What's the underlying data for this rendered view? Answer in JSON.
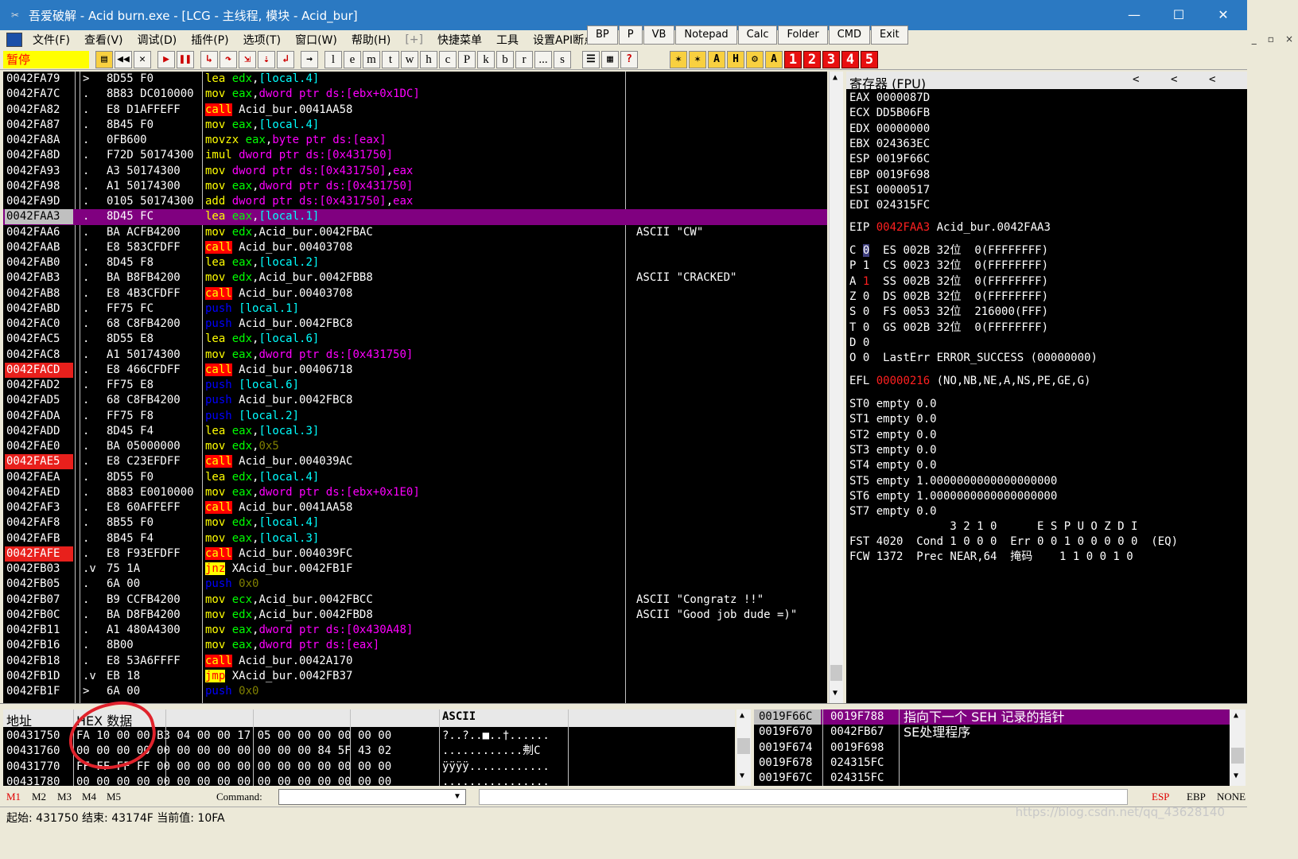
{
  "window": {
    "title": "吾爱破解 - Acid burn.exe - [LCG - 主线程, 模块 - Acid_bur]",
    "minimize": "—",
    "maximize": "☐",
    "close": "✕"
  },
  "menu": {
    "items": [
      "文件(F)",
      "查看(V)",
      "调试(D)",
      "插件(P)",
      "选项(T)",
      "窗口(W)",
      "帮助(H)",
      "[+]",
      "快捷菜单",
      "工具",
      "设置API断点"
    ],
    "quick_buttons": [
      "BP",
      "P",
      "VB",
      "Notepad",
      "Calc",
      "Folder",
      "CMD",
      "Exit"
    ]
  },
  "toolbar": {
    "status": "暂停",
    "letters": [
      "l",
      "e",
      "m",
      "t",
      "w",
      "h",
      "c",
      "P",
      "k",
      "b",
      "r",
      "...",
      "s"
    ],
    "numbers": [
      "1",
      "2",
      "3",
      "4",
      "5"
    ]
  },
  "cpu": {
    "rows": [
      {
        "addr": "0042FA79",
        "g": ">",
        "hex": "8D55 F0",
        "op": "lea",
        "args": "edx,[local.4]",
        "comment": ""
      },
      {
        "addr": "0042FA7C",
        "g": ".",
        "hex": "8B83 DC010000",
        "op": "mov",
        "args": "eax,dword ptr ds:[ebx+0x1DC]",
        "comment": ""
      },
      {
        "addr": "0042FA82",
        "g": ".",
        "hex": "E8 D1AFFEFF",
        "op": "call",
        "args": "Acid_bur.0041AA58",
        "comment": ""
      },
      {
        "addr": "0042FA87",
        "g": ".",
        "hex": "8B45 F0",
        "op": "mov",
        "args": "eax,[local.4]",
        "comment": ""
      },
      {
        "addr": "0042FA8A",
        "g": ".",
        "hex": "0FB600",
        "op": "movzx",
        "args": "eax,byte ptr ds:[eax]",
        "comment": ""
      },
      {
        "addr": "0042FA8D",
        "g": ".",
        "hex": "F72D 50174300",
        "op": "imul",
        "args": "dword ptr ds:[0x431750]",
        "comment": ""
      },
      {
        "addr": "0042FA93",
        "g": ".",
        "hex": "A3 50174300",
        "op": "mov",
        "args": "dword ptr ds:[0x431750],eax",
        "comment": ""
      },
      {
        "addr": "0042FA98",
        "g": ".",
        "hex": "A1 50174300",
        "op": "mov",
        "args": "eax,dword ptr ds:[0x431750]",
        "comment": ""
      },
      {
        "addr": "0042FA9D",
        "g": ".",
        "hex": "0105 50174300",
        "op": "add",
        "args": "dword ptr ds:[0x431750],eax",
        "comment": ""
      },
      {
        "addr": "0042FAA3",
        "g": ".",
        "hex": "8D45 FC",
        "op": "lea",
        "args": "eax,[local.1]",
        "comment": "",
        "selected": true
      },
      {
        "addr": "0042FAA6",
        "g": ".",
        "hex": "BA ACFB4200",
        "op": "mov",
        "args": "edx,Acid_bur.0042FBAC",
        "comment": "ASCII \"CW\""
      },
      {
        "addr": "0042FAAB",
        "g": ".",
        "hex": "E8 583CFDFF",
        "op": "call",
        "args": "Acid_bur.00403708",
        "comment": ""
      },
      {
        "addr": "0042FAB0",
        "g": ".",
        "hex": "8D45 F8",
        "op": "lea",
        "args": "eax,[local.2]",
        "comment": ""
      },
      {
        "addr": "0042FAB3",
        "g": ".",
        "hex": "BA B8FB4200",
        "op": "mov",
        "args": "edx,Acid_bur.0042FBB8",
        "comment": "ASCII \"CRACKED\""
      },
      {
        "addr": "0042FAB8",
        "g": ".",
        "hex": "E8 4B3CFDFF",
        "op": "call",
        "args": "Acid_bur.00403708",
        "comment": ""
      },
      {
        "addr": "0042FABD",
        "g": ".",
        "hex": "FF75 FC",
        "op": "push",
        "args": "[local.1]",
        "comment": ""
      },
      {
        "addr": "0042FAC0",
        "g": ".",
        "hex": "68 C8FB4200",
        "op": "push",
        "args": "Acid_bur.0042FBC8",
        "comment": ""
      },
      {
        "addr": "0042FAC5",
        "g": ".",
        "hex": "8D55 E8",
        "op": "lea",
        "args": "edx,[local.6]",
        "comment": ""
      },
      {
        "addr": "0042FAC8",
        "g": ".",
        "hex": "A1 50174300",
        "op": "mov",
        "args": "eax,dword ptr ds:[0x431750]",
        "comment": ""
      },
      {
        "addr": "0042FACD",
        "g": ".",
        "hex": "E8 466CFDFF",
        "op": "call",
        "args": "Acid_bur.00406718",
        "comment": "",
        "bp": true
      },
      {
        "addr": "0042FAD2",
        "g": ".",
        "hex": "FF75 E8",
        "op": "push",
        "args": "[local.6]",
        "comment": ""
      },
      {
        "addr": "0042FAD5",
        "g": ".",
        "hex": "68 C8FB4200",
        "op": "push",
        "args": "Acid_bur.0042FBC8",
        "comment": ""
      },
      {
        "addr": "0042FADA",
        "g": ".",
        "hex": "FF75 F8",
        "op": "push",
        "args": "[local.2]",
        "comment": ""
      },
      {
        "addr": "0042FADD",
        "g": ".",
        "hex": "8D45 F4",
        "op": "lea",
        "args": "eax,[local.3]",
        "comment": ""
      },
      {
        "addr": "0042FAE0",
        "g": ".",
        "hex": "BA 05000000",
        "op": "mov",
        "args": "edx,0x5",
        "comment": ""
      },
      {
        "addr": "0042FAE5",
        "g": ".",
        "hex": "E8 C23EFDFF",
        "op": "call",
        "args": "Acid_bur.004039AC",
        "comment": "",
        "bp": true
      },
      {
        "addr": "0042FAEA",
        "g": ".",
        "hex": "8D55 F0",
        "op": "lea",
        "args": "edx,[local.4]",
        "comment": ""
      },
      {
        "addr": "0042FAED",
        "g": ".",
        "hex": "8B83 E0010000",
        "op": "mov",
        "args": "eax,dword ptr ds:[ebx+0x1E0]",
        "comment": ""
      },
      {
        "addr": "0042FAF3",
        "g": ".",
        "hex": "E8 60AFFEFF",
        "op": "call",
        "args": "Acid_bur.0041AA58",
        "comment": ""
      },
      {
        "addr": "0042FAF8",
        "g": ".",
        "hex": "8B55 F0",
        "op": "mov",
        "args": "edx,[local.4]",
        "comment": ""
      },
      {
        "addr": "0042FAFB",
        "g": ".",
        "hex": "8B45 F4",
        "op": "mov",
        "args": "eax,[local.3]",
        "comment": ""
      },
      {
        "addr": "0042FAFE",
        "g": ".",
        "hex": "E8 F93EFDFF",
        "op": "call",
        "args": "Acid_bur.004039FC",
        "comment": "",
        "bp": true
      },
      {
        "addr": "0042FB03",
        "g": ".v",
        "hex": "75 1A",
        "op": "jnz",
        "args": "XAcid_bur.0042FB1F",
        "comment": ""
      },
      {
        "addr": "0042FB05",
        "g": ".",
        "hex": "6A 00",
        "op": "push",
        "args": "0x0",
        "comment": ""
      },
      {
        "addr": "0042FB07",
        "g": ".",
        "hex": "B9 CCFB4200",
        "op": "mov",
        "args": "ecx,Acid_bur.0042FBCC",
        "comment": "ASCII \"Congratz !!\""
      },
      {
        "addr": "0042FB0C",
        "g": ".",
        "hex": "BA D8FB4200",
        "op": "mov",
        "args": "edx,Acid_bur.0042FBD8",
        "comment": "ASCII \"Good job dude =)\""
      },
      {
        "addr": "0042FB11",
        "g": ".",
        "hex": "A1 480A4300",
        "op": "mov",
        "args": "eax,dword ptr ds:[0x430A48]",
        "comment": ""
      },
      {
        "addr": "0042FB16",
        "g": ".",
        "hex": "8B00",
        "op": "mov",
        "args": "eax,dword ptr ds:[eax]",
        "comment": ""
      },
      {
        "addr": "0042FB18",
        "g": ".",
        "hex": "E8 53A6FFFF",
        "op": "call",
        "args": "Acid_bur.0042A170",
        "comment": ""
      },
      {
        "addr": "0042FB1D",
        "g": ".v",
        "hex": "EB 18",
        "op": "jmp",
        "args": "XAcid_bur.0042FB37",
        "comment": ""
      },
      {
        "addr": "0042FB1F",
        "g": ">",
        "hex": "6A 00",
        "op": "push",
        "args": "0x0",
        "comment": ""
      }
    ]
  },
  "registers": {
    "header": "寄存器 (FPU)",
    "nav": [
      "<",
      "<",
      "<"
    ],
    "gp": [
      "EAX 0000087D",
      "ECX DD5B06FB",
      "EDX 00000000",
      "EBX 024363EC",
      "ESP 0019F66C",
      "EBP 0019F698",
      "ESI 00000517",
      "EDI 024315FC"
    ],
    "eip_label": "EIP",
    "eip_val": "0042FAA3",
    "eip_desc": "Acid_bur.0042FAA3",
    "flags": [
      {
        "f": "C",
        "v": "0",
        "seg": "ES 002B 32位  0(FFFFFFFF)"
      },
      {
        "f": "P",
        "v": "1",
        "seg": "CS 0023 32位  0(FFFFFFFF)"
      },
      {
        "f": "A",
        "v": "1",
        "seg": "SS 002B 32位  0(FFFFFFFF)"
      },
      {
        "f": "Z",
        "v": "0",
        "seg": "DS 002B 32位  0(FFFFFFFF)"
      },
      {
        "f": "S",
        "v": "0",
        "seg": "FS 0053 32位  216000(FFF)"
      },
      {
        "f": "T",
        "v": "0",
        "seg": "GS 002B 32位  0(FFFFFFFF)"
      },
      {
        "f": "D",
        "v": "0",
        "seg": ""
      },
      {
        "f": "O",
        "v": "0",
        "seg": "LastErr ERROR_SUCCESS (00000000)"
      }
    ],
    "efl_label": "EFL",
    "efl_val": "00000216",
    "efl_desc": "(NO,NB,NE,A,NS,PE,GE,G)",
    "fpu": [
      "ST0 empty 0.0",
      "ST1 empty 0.0",
      "ST2 empty 0.0",
      "ST3 empty 0.0",
      "ST4 empty 0.0",
      "ST5 empty 1.0000000000000000000",
      "ST6 empty 1.0000000000000000000",
      "ST7 empty 0.0"
    ],
    "fpu_hdr": "               3 2 1 0      E S P U O Z D I",
    "fst": "FST 4020  Cond 1 0 0 0  Err 0 0 1 0 0 0 0 0  (EQ)",
    "fcw": "FCW 1372  Prec NEAR,64  掩码    1 1 0 0 1 0"
  },
  "dump": {
    "headers": [
      "地址",
      "HEX 数据",
      "ASCII"
    ],
    "rows": [
      {
        "addr": "00431750",
        "hex": "FA 10 00 00 B3 04 00 00 17 05 00 00 00 00 00 00",
        "ascii": "?..?..■..†......"
      },
      {
        "addr": "00431760",
        "hex": "00 00 00 00 00 00 00 00 00 00 00 00 84 5F 43 02",
        "ascii": "............刜C"
      },
      {
        "addr": "00431770",
        "hex": "FF FF FF FF 00 00 00 00 00 00 00 00 00 00 00 00",
        "ascii": "ÿÿÿÿ............"
      },
      {
        "addr": "00431780",
        "hex": "00 00 00 00 00 00 00 00 00 00 00 00 00 00 00 00",
        "ascii": "................"
      }
    ]
  },
  "stack": {
    "rows": [
      {
        "addr": "0019F66C",
        "val": "0019F788",
        "comment": "指向下一个 SEH 记录的指针",
        "top": true
      },
      {
        "addr": "0019F670",
        "val": "0042FB67",
        "comment": "SE处理程序"
      },
      {
        "addr": "0019F674",
        "val": "0019F698",
        "comment": ""
      },
      {
        "addr": "0019F678",
        "val": "024315FC",
        "comment": ""
      },
      {
        "addr": "0019F67C",
        "val": "024315FC",
        "comment": ""
      }
    ]
  },
  "cmdbar": {
    "marks": [
      "M1",
      "M2",
      "M3",
      "M4",
      "M5"
    ],
    "command_label": "Command:",
    "command_value": "",
    "right": [
      "ESP",
      "EBP",
      "NONE"
    ]
  },
  "statusbar": {
    "text": "起始: 431750 结束: 43174F 当前值: 10FA",
    "watermark": "https://blog.csdn.net/qq_43628140"
  }
}
